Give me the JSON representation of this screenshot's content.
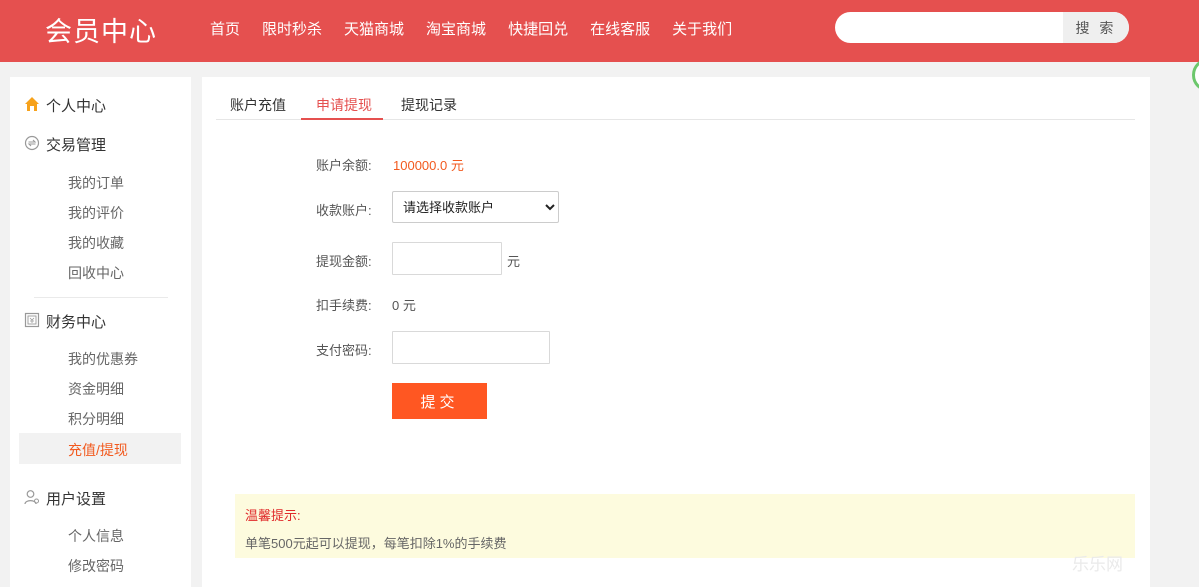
{
  "header": {
    "logo": "会员中心",
    "nav": [
      "首页",
      "限时秒杀",
      "天猫商城",
      "淘宝商城",
      "快捷回兑",
      "在线客服",
      "关于我们"
    ],
    "search": {
      "placeholder": "",
      "button_label": "搜 索"
    }
  },
  "sidebar": {
    "personal_center": "个人中心",
    "trade": {
      "title": "交易管理",
      "items": [
        "我的订单",
        "我的评价",
        "我的收藏",
        "回收中心"
      ]
    },
    "finance": {
      "title": "财务中心",
      "items": [
        "我的优惠券",
        "资金明细",
        "积分明细",
        "充值/提现"
      ],
      "active_index": 3
    },
    "user": {
      "title": "用户设置",
      "items": [
        "个人信息",
        "修改密码"
      ]
    }
  },
  "tabs": [
    "账户充值",
    "申请提现",
    "提现记录"
  ],
  "active_tab": 1,
  "form": {
    "balance_label": "账户余额:",
    "balance_value": "100000.0 元",
    "account_label": "收款账户:",
    "account_selected": "请选择收款账户",
    "amount_label": "提现金额:",
    "amount_unit": "元",
    "fee_label": "扣手续费:",
    "fee_value": "0 元",
    "password_label": "支付密码:",
    "submit_label": "提交"
  },
  "tip": {
    "title": "温馨提示:",
    "text": "单笔500元起可以提现，每笔扣除1%的手续费"
  },
  "watermark": "乐乐网",
  "colors": {
    "header": "#e5504f",
    "accent": "#ff5722",
    "price": "#f25a1f"
  }
}
